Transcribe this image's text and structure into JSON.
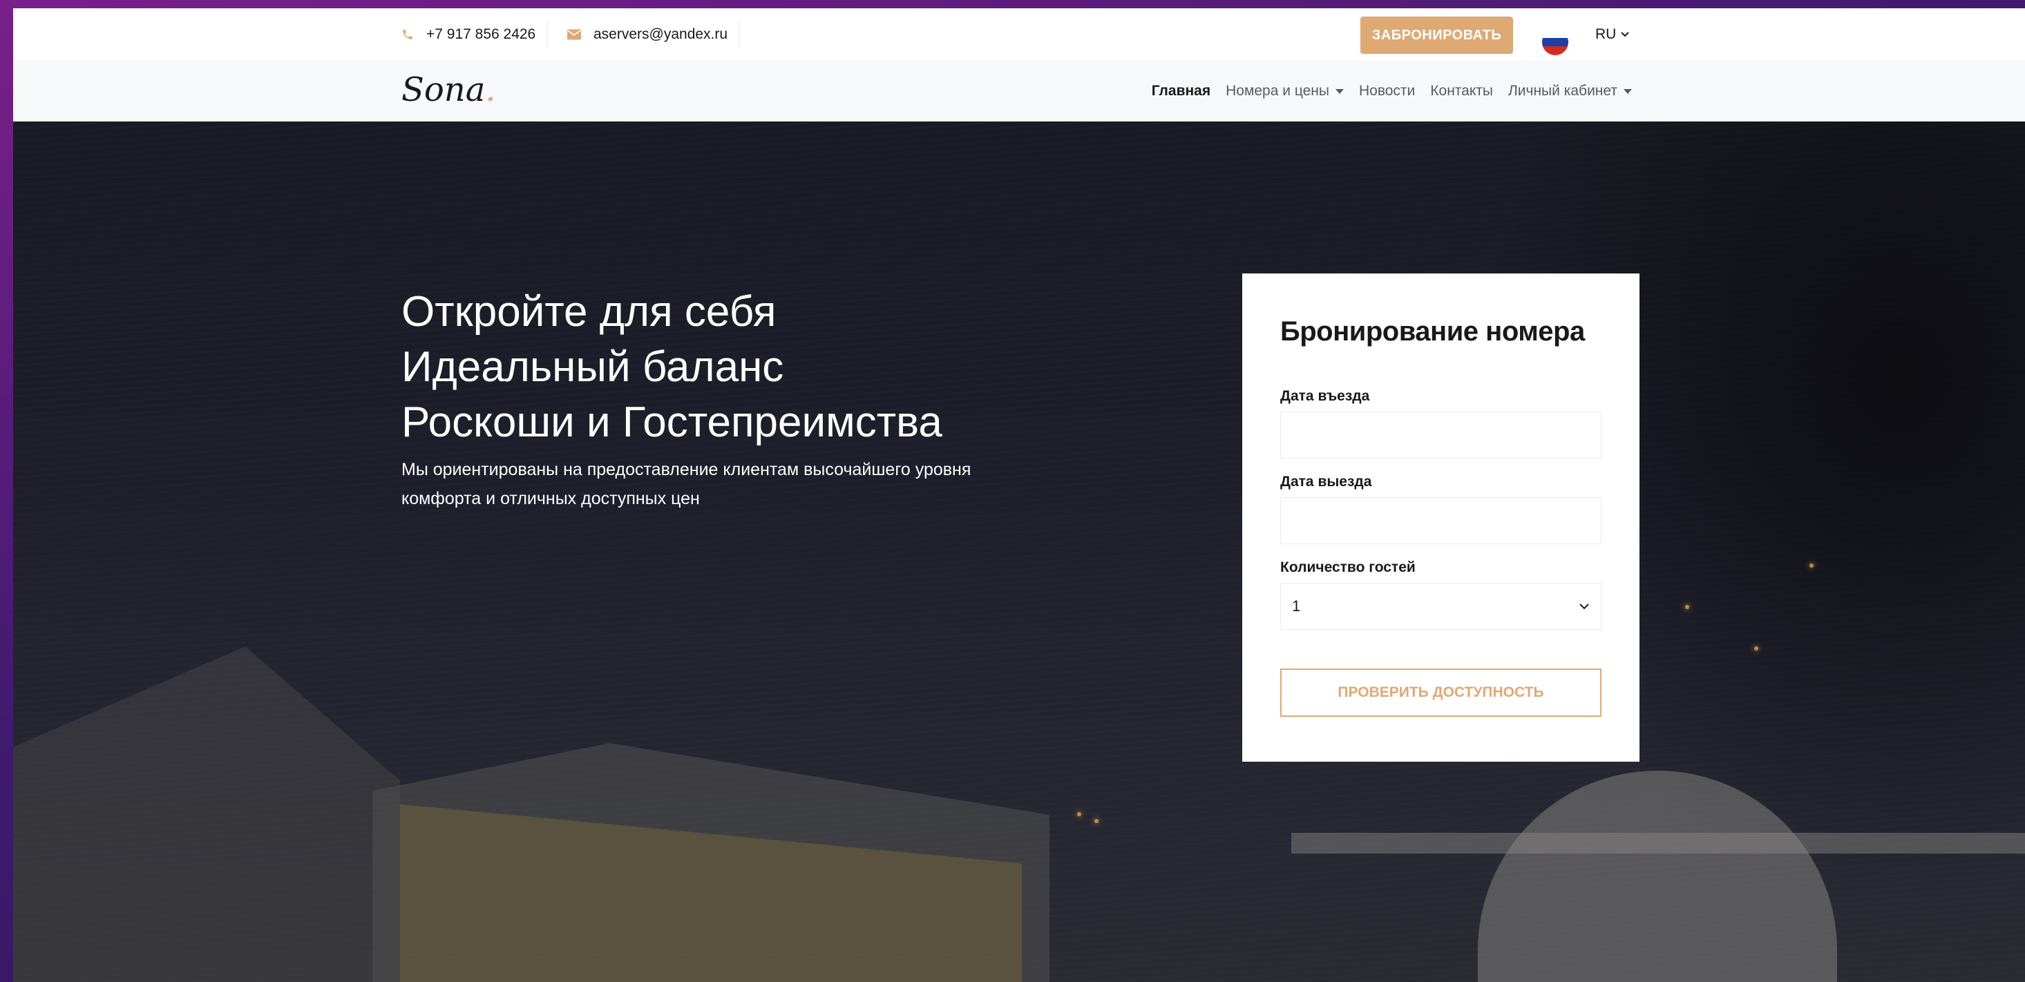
{
  "topbar": {
    "phone": "+7 917 856 2426",
    "email": "aservers@yandex.ru",
    "book_label": "ЗАБРОНИРОВАТЬ",
    "language": "RU"
  },
  "nav": {
    "logo_text": "Sona",
    "logo_dot": ".",
    "items": [
      {
        "label": "Главная"
      },
      {
        "label": "Номера и цены"
      },
      {
        "label": "Новости"
      },
      {
        "label": "Контакты"
      },
      {
        "label": "Личный кабинет"
      }
    ]
  },
  "hero": {
    "title_lines": [
      "Откройте для себя",
      "Идеальный баланс",
      "Роскоши и Гостепреимства"
    ],
    "text": "Мы ориентированы на предоставление клиентам высочайшего уровня комфорта и отличных доступных цен"
  },
  "booking": {
    "title": "Бронирование номера",
    "checkin_label": "Дата въезда",
    "checkin_value": "",
    "checkout_label": "Дата выезда",
    "checkout_value": "",
    "guests_label": "Количество гостей",
    "guests_value": "1",
    "submit_label": "ПРОВЕРИТЬ ДОСТУПНОСТЬ"
  },
  "colors": {
    "accent": "#dfa974",
    "text_dark": "#19191a"
  }
}
